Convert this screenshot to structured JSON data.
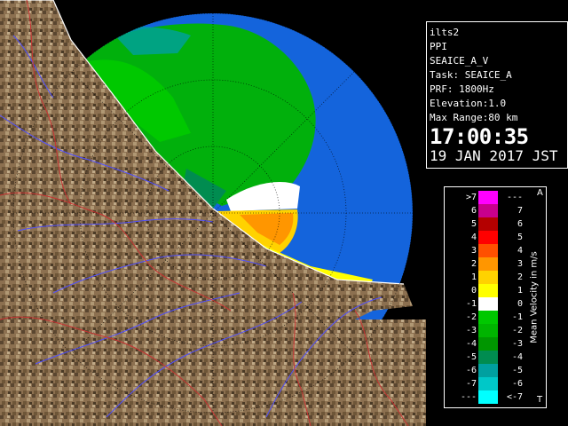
{
  "info": {
    "site": "ilts2",
    "product": "PPI",
    "source": "SEAICE_A_V",
    "task": "Task: SEAICE_A",
    "prf": "PRF: 1800Hz",
    "elevation": "Elevation:1.0",
    "max_range": "Max Range:80 km",
    "time": "17:00:35",
    "date": "19 JAN 2017 JST"
  },
  "legend": {
    "title": "Mean Velocity in m/s",
    "top_mark": "A",
    "bottom_mark": "T",
    "rows": [
      {
        "left": ">7",
        "right": "---",
        "color": "#ff00ff"
      },
      {
        "left": "6",
        "right": "7",
        "color": "#c8008c"
      },
      {
        "left": "5",
        "right": "6",
        "color": "#b40000"
      },
      {
        "left": "4",
        "right": "5",
        "color": "#ff0000"
      },
      {
        "left": "3",
        "right": "4",
        "color": "#ff5000"
      },
      {
        "left": "2",
        "right": "3",
        "color": "#ff9600"
      },
      {
        "left": "1",
        "right": "2",
        "color": "#ffd200"
      },
      {
        "left": "0",
        "right": "1",
        "color": "#ffff00"
      },
      {
        "left": "-1",
        "right": "0",
        "color": "#ffffff"
      },
      {
        "left": "-2",
        "right": "-1",
        "color": "#00c800"
      },
      {
        "left": "-3",
        "right": "-2",
        "color": "#00b400"
      },
      {
        "left": "-4",
        "right": "-3",
        "color": "#009600"
      },
      {
        "left": "-5",
        "right": "-4",
        "color": "#008c50"
      },
      {
        "left": "-6",
        "right": "-5",
        "color": "#00a0a0"
      },
      {
        "left": "-7",
        "right": "-6",
        "color": "#00c8c8"
      },
      {
        "left": "---",
        "right": "<-7",
        "color": "#00ffff"
      }
    ]
  },
  "colors": {
    "sea": "#1464dc",
    "background": "#000000",
    "land": "#8c7050",
    "rivers": "#5050ff",
    "boundaries": "#c83232"
  }
}
